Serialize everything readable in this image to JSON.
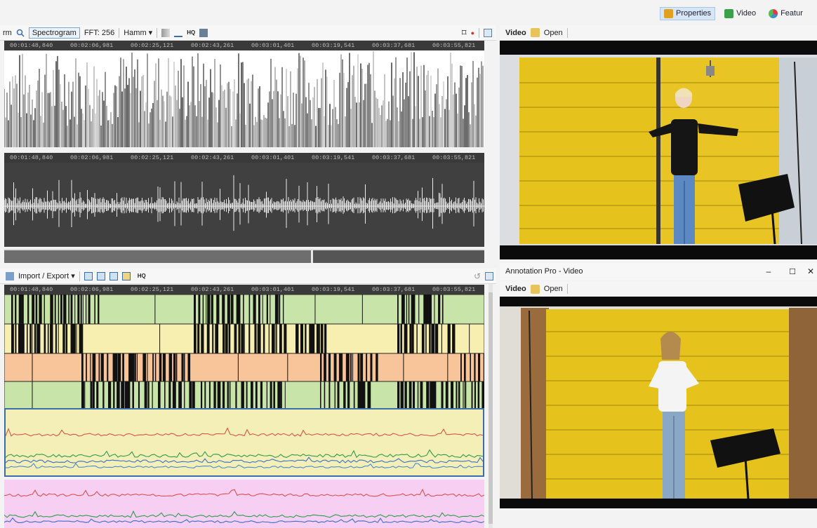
{
  "top_tabs": [
    {
      "label": "Properties",
      "icon": "properties-icon",
      "color": "#e0a020",
      "active": true
    },
    {
      "label": "Video",
      "icon": "video-icon",
      "color": "#3aa04a",
      "active": false
    },
    {
      "label": "Featur",
      "icon": "features-icon",
      "color": "#3b8fd0",
      "active": false
    }
  ],
  "spectrogram_toolbar": {
    "view_label": "rm",
    "spectrogram_label": "Spectrogram",
    "fft_label": "FFT: 256",
    "window_label": "Hamm",
    "hq_label": "HQ"
  },
  "time_ticks": [
    "00:01:48,840",
    "00:02:06,981",
    "00:02:25,121",
    "00:02:43,261",
    "00:03:01,401",
    "00:03:19,541",
    "00:03:37,681",
    "00:03:55,821"
  ],
  "annotation_toolbar": {
    "import_export_label": "Import / Export",
    "hq_label": "HQ"
  },
  "video_pane_top": {
    "video_label": "Video",
    "open_label": "Open"
  },
  "video_pane_bottom": {
    "window_title": "Annotation Pro - Video",
    "video_label": "Video",
    "open_label": "Open"
  },
  "colors": {
    "tier_green": "#c9e4a8",
    "tier_yellow": "#f6efb0",
    "tier_orange": "#f8c59a",
    "feature_yellow": "#f4efb6",
    "feature_pink": "#f6cff2",
    "wall_yellow": "#e6c21c"
  }
}
